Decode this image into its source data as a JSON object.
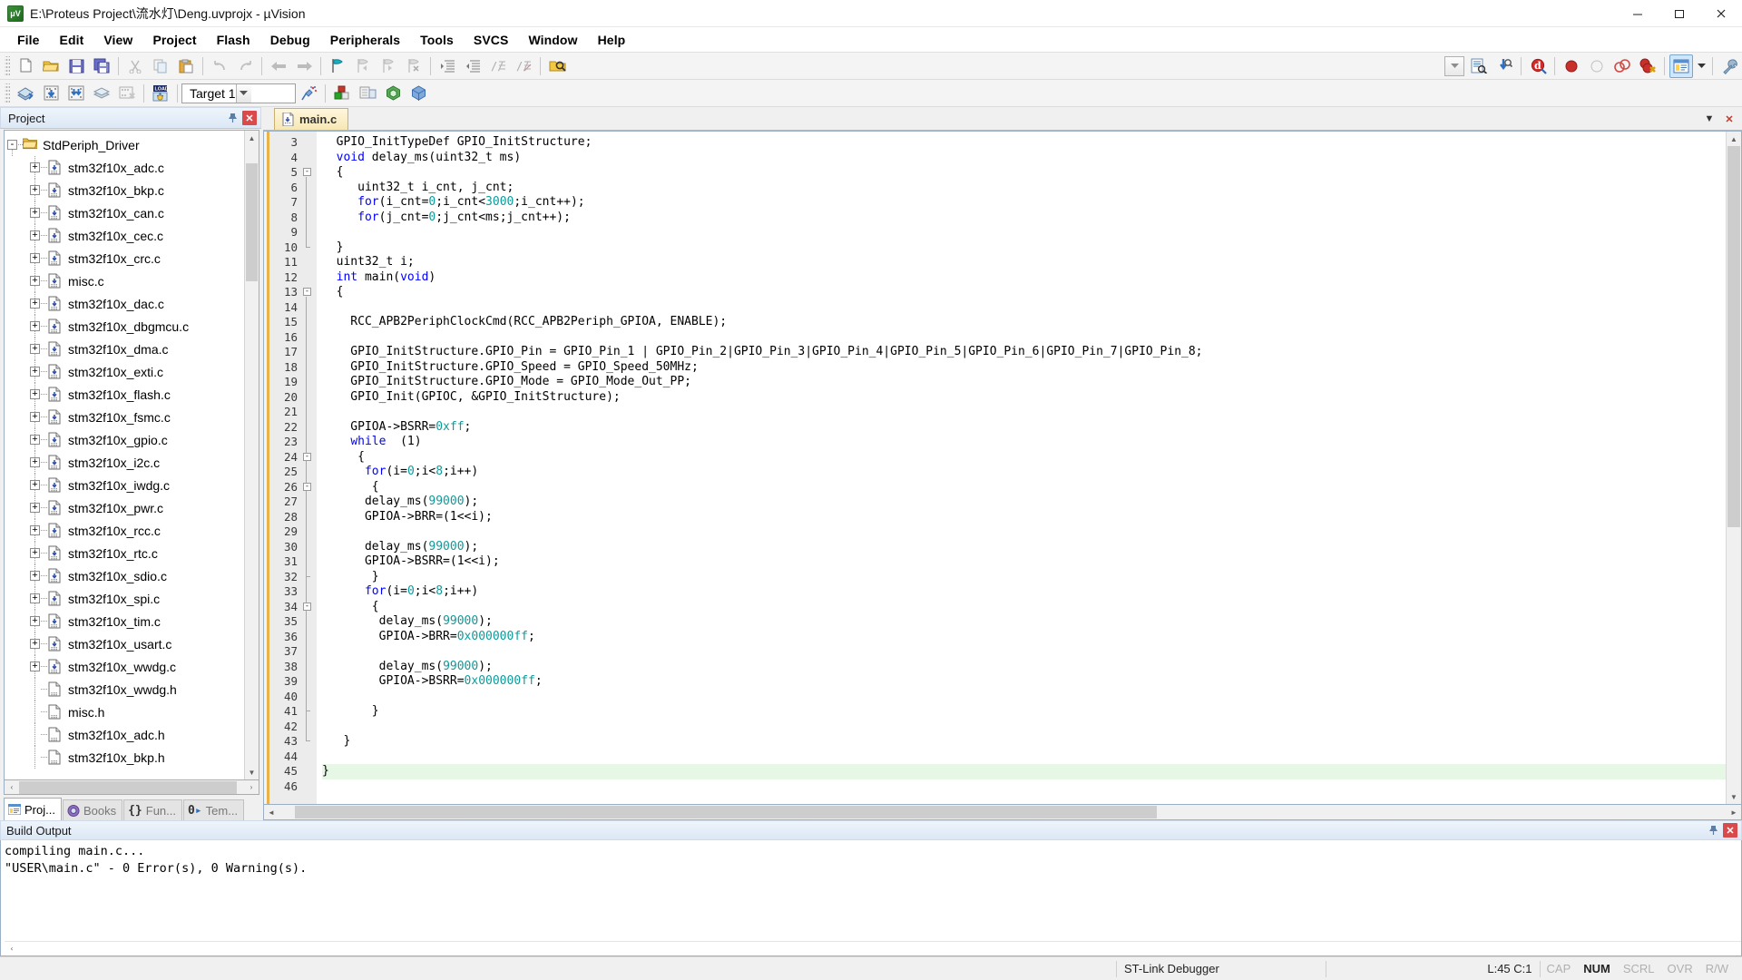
{
  "titlebar": {
    "app_icon": "uvision-logo-icon",
    "title": "E:\\Proteus Project\\流水灯\\Deng.uvprojx - µVision",
    "minimize": "–",
    "maximize": "□",
    "close": "✕"
  },
  "menubar": {
    "items": [
      {
        "label": "File"
      },
      {
        "label": "Edit"
      },
      {
        "label": "View"
      },
      {
        "label": "Project"
      },
      {
        "label": "Flash"
      },
      {
        "label": "Debug"
      },
      {
        "label": "Peripherals"
      },
      {
        "label": "Tools"
      },
      {
        "label": "SVCS"
      },
      {
        "label": "Window"
      },
      {
        "label": "Help"
      }
    ]
  },
  "toolbar_main": {
    "buttons": [
      {
        "name": "new-file-icon",
        "title": "New"
      },
      {
        "name": "open-file-icon",
        "title": "Open"
      },
      {
        "name": "save-icon",
        "title": "Save"
      },
      {
        "name": "save-all-icon",
        "title": "Save All"
      },
      {
        "name": "cut-icon",
        "title": "Cut"
      },
      {
        "name": "copy-icon",
        "title": "Copy"
      },
      {
        "name": "paste-icon",
        "title": "Paste"
      },
      {
        "name": "undo-icon",
        "title": "Undo"
      },
      {
        "name": "redo-icon",
        "title": "Redo"
      },
      {
        "name": "navigate-back-icon",
        "title": "Back"
      },
      {
        "name": "navigate-forward-icon",
        "title": "Forward"
      },
      {
        "name": "bookmark-toggle-icon",
        "title": "Insert/Remove Bookmark"
      },
      {
        "name": "bookmark-prev-icon",
        "title": "Previous Bookmark"
      },
      {
        "name": "bookmark-next-icon",
        "title": "Next Bookmark"
      },
      {
        "name": "bookmark-clear-icon",
        "title": "Clear All Bookmarks"
      },
      {
        "name": "indent-right-icon",
        "title": "Indent"
      },
      {
        "name": "indent-left-icon",
        "title": "Unindent"
      },
      {
        "name": "comment-icon",
        "title": "Comment"
      },
      {
        "name": "uncomment-icon",
        "title": "Uncomment"
      },
      {
        "name": "find-in-files-icon",
        "title": "Find in Files"
      }
    ],
    "search_value": "",
    "search_placeholder": "",
    "right_buttons": [
      {
        "name": "find-icon",
        "title": "Find"
      },
      {
        "name": "incremental-find-icon",
        "title": "Incremental Find"
      },
      {
        "name": "browse-symbols-icon",
        "title": "Browse Symbols"
      },
      {
        "name": "breakpoint-insert-icon",
        "title": "Insert/Remove Breakpoint"
      },
      {
        "name": "breakpoint-enable-icon",
        "title": "Enable/Disable Breakpoint"
      },
      {
        "name": "breakpoint-disable-all-icon",
        "title": "Disable All Breakpoints"
      },
      {
        "name": "breakpoint-kill-all-icon",
        "title": "Kill All Breakpoints"
      },
      {
        "name": "manage-windows-icon",
        "title": "Manage Windows"
      },
      {
        "name": "configure-icon",
        "title": "Configuration Wizard"
      }
    ]
  },
  "toolbar_build": {
    "buttons": [
      {
        "name": "translate-icon",
        "title": "Translate"
      },
      {
        "name": "build-icon",
        "title": "Build"
      },
      {
        "name": "rebuild-icon",
        "title": "Rebuild"
      },
      {
        "name": "batch-build-icon",
        "title": "Batch Build"
      },
      {
        "name": "stop-build-icon",
        "title": "Stop Build"
      },
      {
        "name": "download-icon",
        "title": "Download"
      }
    ],
    "target_value": "Target 1",
    "right_buttons": [
      {
        "name": "target-options-icon",
        "title": "Options for Target"
      },
      {
        "name": "manage-project-items-icon",
        "title": "Manage Project Items"
      },
      {
        "name": "pack-installer-icon",
        "title": "Pack Installer"
      },
      {
        "name": "run-config-icon",
        "title": "Manage Run-Time Environment"
      }
    ]
  },
  "project_panel": {
    "title": "Project",
    "pin_icon": "pin-icon",
    "close_icon": "close-icon",
    "tree": [
      {
        "label": "StdPeriph_Driver",
        "kind": "folder",
        "expander": "-",
        "level": 0
      },
      {
        "label": "stm32f10x_adc.c",
        "kind": "c-file",
        "expander": "+",
        "level": 1
      },
      {
        "label": "stm32f10x_bkp.c",
        "kind": "c-file",
        "expander": "+",
        "level": 1
      },
      {
        "label": "stm32f10x_can.c",
        "kind": "c-file",
        "expander": "+",
        "level": 1
      },
      {
        "label": "stm32f10x_cec.c",
        "kind": "c-file",
        "expander": "+",
        "level": 1
      },
      {
        "label": "stm32f10x_crc.c",
        "kind": "c-file",
        "expander": "+",
        "level": 1
      },
      {
        "label": "misc.c",
        "kind": "c-file",
        "expander": "+",
        "level": 1
      },
      {
        "label": "stm32f10x_dac.c",
        "kind": "c-file",
        "expander": "+",
        "level": 1
      },
      {
        "label": "stm32f10x_dbgmcu.c",
        "kind": "c-file",
        "expander": "+",
        "level": 1
      },
      {
        "label": "stm32f10x_dma.c",
        "kind": "c-file",
        "expander": "+",
        "level": 1
      },
      {
        "label": "stm32f10x_exti.c",
        "kind": "c-file",
        "expander": "+",
        "level": 1
      },
      {
        "label": "stm32f10x_flash.c",
        "kind": "c-file",
        "expander": "+",
        "level": 1
      },
      {
        "label": "stm32f10x_fsmc.c",
        "kind": "c-file",
        "expander": "+",
        "level": 1
      },
      {
        "label": "stm32f10x_gpio.c",
        "kind": "c-file",
        "expander": "+",
        "level": 1
      },
      {
        "label": "stm32f10x_i2c.c",
        "kind": "c-file",
        "expander": "+",
        "level": 1
      },
      {
        "label": "stm32f10x_iwdg.c",
        "kind": "c-file",
        "expander": "+",
        "level": 1
      },
      {
        "label": "stm32f10x_pwr.c",
        "kind": "c-file",
        "expander": "+",
        "level": 1
      },
      {
        "label": "stm32f10x_rcc.c",
        "kind": "c-file",
        "expander": "+",
        "level": 1
      },
      {
        "label": "stm32f10x_rtc.c",
        "kind": "c-file",
        "expander": "+",
        "level": 1
      },
      {
        "label": "stm32f10x_sdio.c",
        "kind": "c-file",
        "expander": "+",
        "level": 1
      },
      {
        "label": "stm32f10x_spi.c",
        "kind": "c-file",
        "expander": "+",
        "level": 1
      },
      {
        "label": "stm32f10x_tim.c",
        "kind": "c-file",
        "expander": "+",
        "level": 1
      },
      {
        "label": "stm32f10x_usart.c",
        "kind": "c-file",
        "expander": "+",
        "level": 1
      },
      {
        "label": "stm32f10x_wwdg.c",
        "kind": "c-file",
        "expander": "+",
        "level": 1
      },
      {
        "label": "stm32f10x_wwdg.h",
        "kind": "h-file",
        "expander": "",
        "level": 1
      },
      {
        "label": "misc.h",
        "kind": "h-file",
        "expander": "",
        "level": 1
      },
      {
        "label": "stm32f10x_adc.h",
        "kind": "h-file",
        "expander": "",
        "level": 1
      },
      {
        "label": "stm32f10x_bkp.h",
        "kind": "h-file",
        "expander": "",
        "level": 1
      }
    ],
    "tabs": [
      {
        "label": "Proj...",
        "icon": "project-icon",
        "selected": true
      },
      {
        "label": "Books",
        "icon": "books-icon",
        "selected": false
      },
      {
        "label": "Fun...",
        "icon": "functions-icon",
        "selected": false
      },
      {
        "label": "Tem...",
        "icon": "templates-icon",
        "selected": false
      }
    ],
    "hscroll_left": "‹",
    "hscroll_right": "›"
  },
  "editor": {
    "tabs": [
      {
        "label": "main.c",
        "icon": "c-file-icon",
        "selected": true
      }
    ],
    "tab_controls": [
      {
        "name": "tab-list-icon",
        "label": "▼"
      },
      {
        "name": "tab-close-icon",
        "label": "✕"
      }
    ],
    "current_line": 45,
    "lines": [
      {
        "n": 3,
        "tokens": [
          {
            "t": "  GPIO_InitTypeDef GPIO_InitStructure;",
            "c": ""
          }
        ]
      },
      {
        "n": 4,
        "tokens": [
          {
            "t": "  ",
            "c": ""
          },
          {
            "t": "void",
            "c": "kw"
          },
          {
            "t": " delay_ms(uint32_t ms)",
            "c": ""
          }
        ]
      },
      {
        "n": 5,
        "tokens": [
          {
            "t": "  {",
            "c": ""
          }
        ],
        "fold": "-"
      },
      {
        "n": 6,
        "tokens": [
          {
            "t": "     uint32_t i_cnt, j_cnt;",
            "c": ""
          }
        ]
      },
      {
        "n": 7,
        "tokens": [
          {
            "t": "     ",
            "c": ""
          },
          {
            "t": "for",
            "c": "kw"
          },
          {
            "t": "(i_cnt=",
            "c": ""
          },
          {
            "t": "0",
            "c": "num"
          },
          {
            "t": ";i_cnt<",
            "c": ""
          },
          {
            "t": "3000",
            "c": "num"
          },
          {
            "t": ";i_cnt++);",
            "c": ""
          }
        ]
      },
      {
        "n": 8,
        "tokens": [
          {
            "t": "     ",
            "c": ""
          },
          {
            "t": "for",
            "c": "kw"
          },
          {
            "t": "(j_cnt=",
            "c": ""
          },
          {
            "t": "0",
            "c": "num"
          },
          {
            "t": ";j_cnt<ms;j_cnt++);",
            "c": ""
          }
        ]
      },
      {
        "n": 9,
        "tokens": [
          {
            "t": "",
            "c": ""
          }
        ]
      },
      {
        "n": 10,
        "tokens": [
          {
            "t": "  }",
            "c": ""
          }
        ]
      },
      {
        "n": 11,
        "tokens": [
          {
            "t": "  uint32_t i;",
            "c": ""
          }
        ]
      },
      {
        "n": 12,
        "tokens": [
          {
            "t": "  ",
            "c": ""
          },
          {
            "t": "int",
            "c": "kw"
          },
          {
            "t": " main(",
            "c": ""
          },
          {
            "t": "void",
            "c": "kw"
          },
          {
            "t": ")",
            "c": ""
          }
        ]
      },
      {
        "n": 13,
        "tokens": [
          {
            "t": "  {",
            "c": ""
          }
        ],
        "fold": "-"
      },
      {
        "n": 14,
        "tokens": [
          {
            "t": "",
            "c": ""
          }
        ]
      },
      {
        "n": 15,
        "tokens": [
          {
            "t": "    RCC_APB2PeriphClockCmd(RCC_APB2Periph_GPIOA, ENABLE);",
            "c": ""
          }
        ]
      },
      {
        "n": 16,
        "tokens": [
          {
            "t": "",
            "c": ""
          }
        ]
      },
      {
        "n": 17,
        "tokens": [
          {
            "t": "    GPIO_InitStructure.GPIO_Pin = GPIO_Pin_1 | GPIO_Pin_2|GPIO_Pin_3|GPIO_Pin_4|GPIO_Pin_5|GPIO_Pin_6|GPIO_Pin_7|GPIO_Pin_8;",
            "c": ""
          }
        ]
      },
      {
        "n": 18,
        "tokens": [
          {
            "t": "    GPIO_InitStructure.GPIO_Speed = GPIO_Speed_50MHz;",
            "c": ""
          }
        ]
      },
      {
        "n": 19,
        "tokens": [
          {
            "t": "    GPIO_InitStructure.GPIO_Mode = GPIO_Mode_Out_PP;",
            "c": ""
          }
        ]
      },
      {
        "n": 20,
        "tokens": [
          {
            "t": "    GPIO_Init(GPIOC, &GPIO_InitStructure);",
            "c": ""
          }
        ]
      },
      {
        "n": 21,
        "tokens": [
          {
            "t": "",
            "c": ""
          }
        ]
      },
      {
        "n": 22,
        "tokens": [
          {
            "t": "    GPIOA->BSRR=",
            "c": ""
          },
          {
            "t": "0xff",
            "c": "num"
          },
          {
            "t": ";",
            "c": ""
          }
        ]
      },
      {
        "n": 23,
        "tokens": [
          {
            "t": "    ",
            "c": ""
          },
          {
            "t": "while",
            "c": "kw"
          },
          {
            "t": "  (1)",
            "c": ""
          }
        ]
      },
      {
        "n": 24,
        "tokens": [
          {
            "t": "     {",
            "c": ""
          }
        ],
        "fold": "-"
      },
      {
        "n": 25,
        "tokens": [
          {
            "t": "      ",
            "c": ""
          },
          {
            "t": "for",
            "c": "kw"
          },
          {
            "t": "(i=",
            "c": ""
          },
          {
            "t": "0",
            "c": "num"
          },
          {
            "t": ";i<",
            "c": ""
          },
          {
            "t": "8",
            "c": "num"
          },
          {
            "t": ";i++)",
            "c": ""
          }
        ]
      },
      {
        "n": 26,
        "tokens": [
          {
            "t": "       {",
            "c": ""
          }
        ],
        "fold": "-"
      },
      {
        "n": 27,
        "tokens": [
          {
            "t": "      delay_ms(",
            "c": ""
          },
          {
            "t": "99000",
            "c": "num"
          },
          {
            "t": ");",
            "c": ""
          }
        ]
      },
      {
        "n": 28,
        "tokens": [
          {
            "t": "      GPIOA->BRR=(1<<i);",
            "c": ""
          }
        ]
      },
      {
        "n": 29,
        "tokens": [
          {
            "t": "",
            "c": ""
          }
        ]
      },
      {
        "n": 30,
        "tokens": [
          {
            "t": "      delay_ms(",
            "c": ""
          },
          {
            "t": "99000",
            "c": "num"
          },
          {
            "t": ");",
            "c": ""
          }
        ]
      },
      {
        "n": 31,
        "tokens": [
          {
            "t": "      GPIOA->BSRR=(1<<i);",
            "c": ""
          }
        ]
      },
      {
        "n": 32,
        "tokens": [
          {
            "t": "       }",
            "c": ""
          }
        ]
      },
      {
        "n": 33,
        "tokens": [
          {
            "t": "      ",
            "c": ""
          },
          {
            "t": "for",
            "c": "kw"
          },
          {
            "t": "(i=",
            "c": ""
          },
          {
            "t": "0",
            "c": "num"
          },
          {
            "t": ";i<",
            "c": ""
          },
          {
            "t": "8",
            "c": "num"
          },
          {
            "t": ";i++)",
            "c": ""
          }
        ]
      },
      {
        "n": 34,
        "tokens": [
          {
            "t": "       {",
            "c": ""
          }
        ],
        "fold": "-"
      },
      {
        "n": 35,
        "tokens": [
          {
            "t": "        delay_ms(",
            "c": ""
          },
          {
            "t": "99000",
            "c": "num"
          },
          {
            "t": ");",
            "c": ""
          }
        ]
      },
      {
        "n": 36,
        "tokens": [
          {
            "t": "        GPIOA->BRR=",
            "c": ""
          },
          {
            "t": "0x000000ff",
            "c": "num"
          },
          {
            "t": ";",
            "c": ""
          }
        ]
      },
      {
        "n": 37,
        "tokens": [
          {
            "t": "",
            "c": ""
          }
        ]
      },
      {
        "n": 38,
        "tokens": [
          {
            "t": "        delay_ms(",
            "c": ""
          },
          {
            "t": "99000",
            "c": "num"
          },
          {
            "t": ");",
            "c": ""
          }
        ]
      },
      {
        "n": 39,
        "tokens": [
          {
            "t": "        GPIOA->BSRR=",
            "c": ""
          },
          {
            "t": "0x000000ff",
            "c": "num"
          },
          {
            "t": ";",
            "c": ""
          }
        ]
      },
      {
        "n": 40,
        "tokens": [
          {
            "t": "",
            "c": ""
          }
        ]
      },
      {
        "n": 41,
        "tokens": [
          {
            "t": "       }",
            "c": ""
          }
        ]
      },
      {
        "n": 42,
        "tokens": [
          {
            "t": "",
            "c": ""
          }
        ]
      },
      {
        "n": 43,
        "tokens": [
          {
            "t": "   }",
            "c": ""
          }
        ]
      },
      {
        "n": 44,
        "tokens": [
          {
            "t": "",
            "c": ""
          }
        ]
      },
      {
        "n": 45,
        "tokens": [
          {
            "t": "}",
            "c": ""
          }
        ],
        "current": true
      },
      {
        "n": 46,
        "tokens": [
          {
            "t": "",
            "c": ""
          }
        ]
      }
    ]
  },
  "build_output": {
    "title": "Build Output",
    "pin_icon": "pin-icon",
    "close_icon": "close-icon",
    "lines": [
      "compiling main.c...",
      "\"USER\\main.c\" - 0 Error(s), 0 Warning(s)."
    ]
  },
  "statusbar": {
    "debugger": "ST-Link Debugger",
    "position": "L:45 C:1",
    "indicators": [
      {
        "label": "CAP",
        "active": false
      },
      {
        "label": "NUM",
        "active": true
      },
      {
        "label": "SCRL",
        "active": false
      },
      {
        "label": "OVR",
        "active": false
      },
      {
        "label": "R/W",
        "active": false
      }
    ]
  },
  "colors": {
    "keyword": "#0000ff",
    "number": "#0d9a9a",
    "current_line": "#e6f7e6",
    "tab_active": "#f6e7b4",
    "panel_header": "#dce8f5"
  }
}
